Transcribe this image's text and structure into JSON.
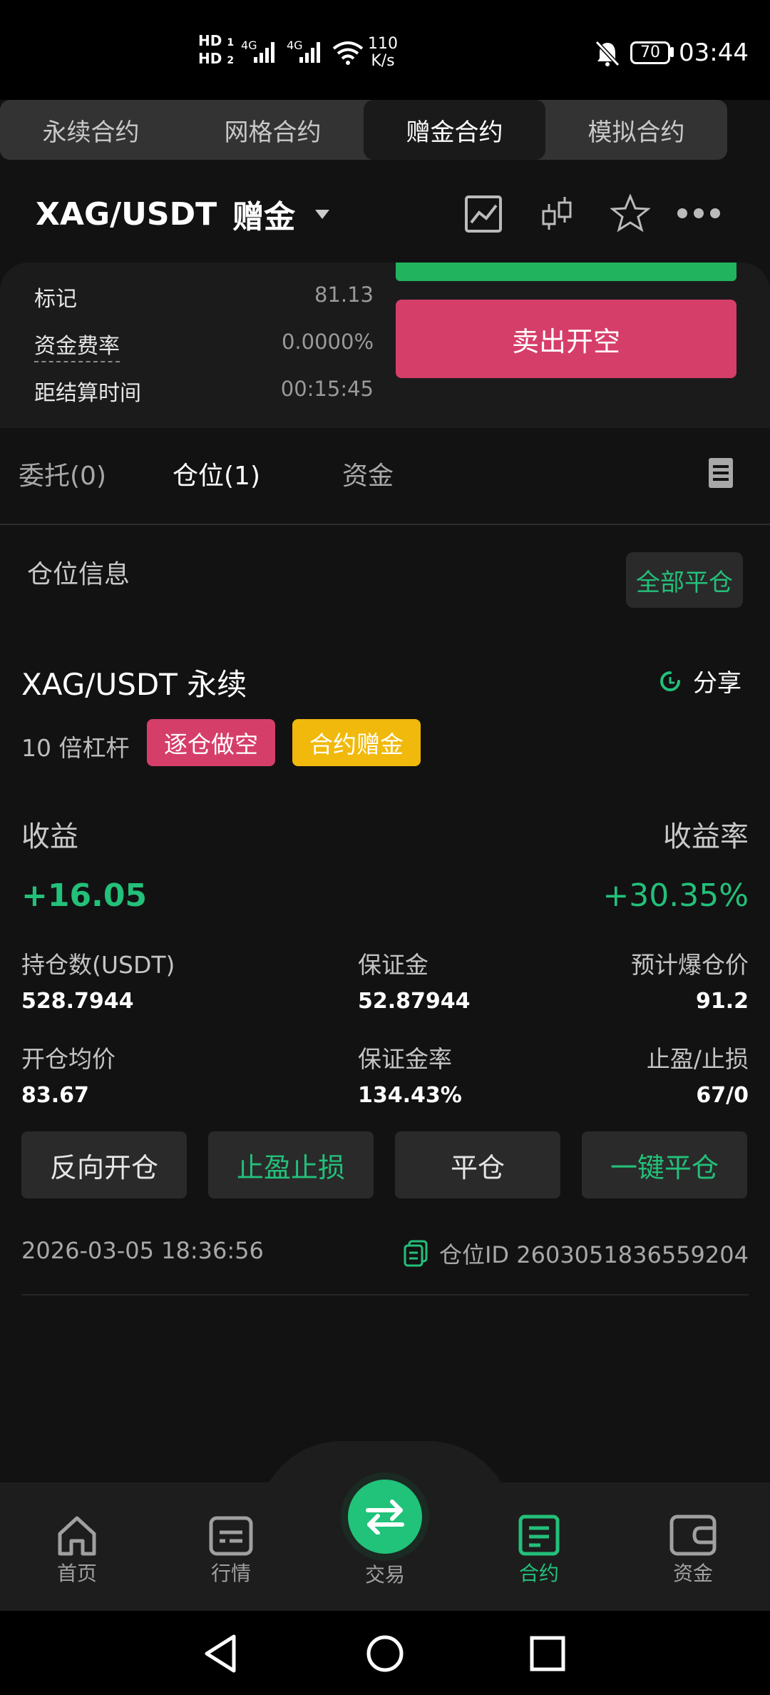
{
  "status_bar": {
    "hd1": "HD",
    "hd1_sub": "1",
    "hd2": "HD",
    "hd2_sub": "2",
    "net1": "4G",
    "net2": "4G",
    "speed_value": "110",
    "speed_unit": "K/s",
    "battery": "70",
    "time": "03:44"
  },
  "segment_tabs": [
    "永续合约",
    "网格合约",
    "赠金合约",
    "模拟合约"
  ],
  "header": {
    "symbol": "XAG/USDT",
    "mode": "赠金"
  },
  "info": {
    "mark_label": "标记",
    "mark_value": "81.13",
    "funding_label": "资金费率",
    "funding_value": "0.0000%",
    "settle_label": "距结算时间",
    "settle_value": "00:15:45"
  },
  "sell_button": "卖出开空",
  "order_tabs": {
    "orders": "委托(0)",
    "positions": "仓位(1)",
    "funds": "资金"
  },
  "position": {
    "section_title": "仓位信息",
    "close_all": "全部平仓",
    "pair": "XAG/USDT 永续",
    "share": "分享",
    "leverage": "10 倍杠杆",
    "tag_short": "逐仓做空",
    "tag_bonus": "合约赠金",
    "pnl_label": "收益",
    "pnl_rate_label": "收益率",
    "pnl": "+16.05",
    "pnl_rate": "+30.35%",
    "size_label": "持仓数(USDT)",
    "size": "528.7944",
    "margin_label": "保证金",
    "margin": "52.87944",
    "liq_label": "预计爆仓价",
    "liq": "91.2",
    "entry_label": "开仓均价",
    "entry": "83.67",
    "margin_ratio_label": "保证金率",
    "margin_ratio": "134.43%",
    "tpsl_label": "止盈/止损",
    "tpsl": "67/0",
    "actions": [
      "反向开仓",
      "止盈止损",
      "平仓",
      "一键平仓"
    ],
    "timestamp": "2026-03-05 18:36:56",
    "position_id": "仓位ID 2603051836559204"
  },
  "bottom_nav": [
    "首页",
    "行情",
    "交易",
    "合约",
    "资金"
  ],
  "colors": {
    "green": "#23c07a",
    "red": "#d63e6a",
    "yellow": "#f0b90b"
  }
}
